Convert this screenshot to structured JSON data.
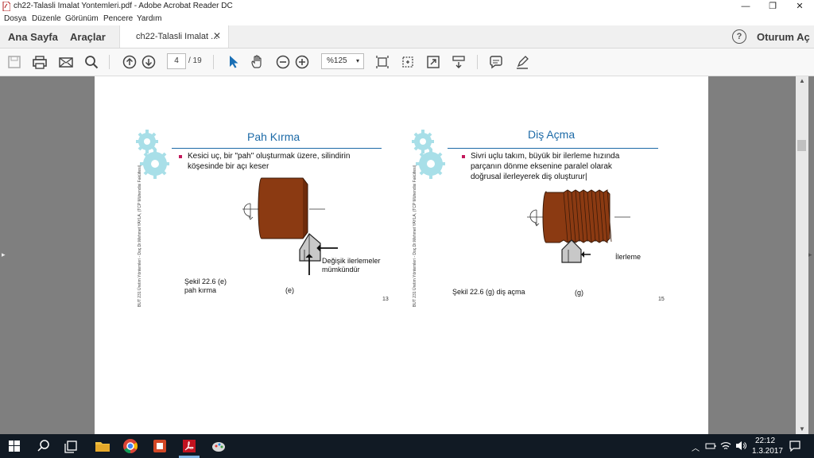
{
  "window": {
    "title": "ch22-Talasli Imalat Yontemleri.pdf - Adobe Acrobat Reader DC",
    "minimize_glyph": "—",
    "maximize_glyph": "❐",
    "close_glyph": "✕"
  },
  "menu": [
    "Dosya",
    "Düzenle",
    "Görünüm",
    "Pencere",
    "Yardım"
  ],
  "nav": {
    "home": "Ana Sayfa",
    "tools": "Araçlar",
    "doc_tab": "ch22-Talasli Imalat ...",
    "doc_tab_close": "✕",
    "help": "?",
    "signin": "Oturum Aç"
  },
  "toolbar": {
    "page_current": "4",
    "page_total": "/ 19",
    "zoom": "%125",
    "zoom_arrow": "▾",
    "icons": [
      "save-icon",
      "print-icon",
      "email-icon",
      "search-icon",
      "page-up-icon",
      "page-down-icon",
      "select-arrow-icon",
      "hand-icon",
      "zoom-out-icon",
      "zoom-in-icon",
      "fit-page-icon",
      "rotate-icon",
      "fullscreen-icon",
      "scroll-mode-icon",
      "comment-icon",
      "highlight-icon"
    ],
    "accent_color": "#1a6fb5"
  },
  "slides": [
    {
      "title": "Pah Kırma",
      "bullet": [
        "Kesici uç, bir \"pah\" oluşturmak üzere, silindirin",
        "köşesinde bir açı keser"
      ],
      "callout": [
        "Değişik ilerlemeler",
        "mümkündür"
      ],
      "caption": [
        "Şekil 22.6 (e)",
        "pah kırma"
      ],
      "label": "(e)",
      "page": "13",
      "vertical": "BUT 231 Üretim Yöntemleri - Doç.Dr.Mehmet YAYLA, (TCP Mühendisi Fakültesi)"
    },
    {
      "title": "Diş Açma",
      "bullet": [
        "Sivri uçlu takım, büyük bir ilerleme hızında",
        "parçanın dönme eksenine paralel olarak",
        "doğrusal  ilerleyerek diş oluşturur|"
      ],
      "callout": [
        "İlerleme"
      ],
      "caption": [
        "Şekil 22.6 (g) diş açma"
      ],
      "label": "(g)",
      "page": "15",
      "vertical": "BUT 231 Üretim Yöntemleri - Doç.Dr.Mehmet YAYLA, (TCP Mühendisi Fakültesi)"
    }
  ],
  "colors": {
    "title_blue": "#1c6aa7",
    "bullet_pink": "#c2185b",
    "workpiece_brown": "#8b3a12",
    "gear_cyan": "#a8dfe8",
    "doc_gray": "#7f7f7f"
  },
  "taskbar": {
    "time": "22:12",
    "date": "1.3.2017",
    "apps": [
      "windows-start-icon",
      "search-icon",
      "task-view-icon",
      "file-explorer-icon",
      "chrome-icon",
      "app-red-icon",
      "acrobat-icon",
      "paint-icon"
    ]
  }
}
